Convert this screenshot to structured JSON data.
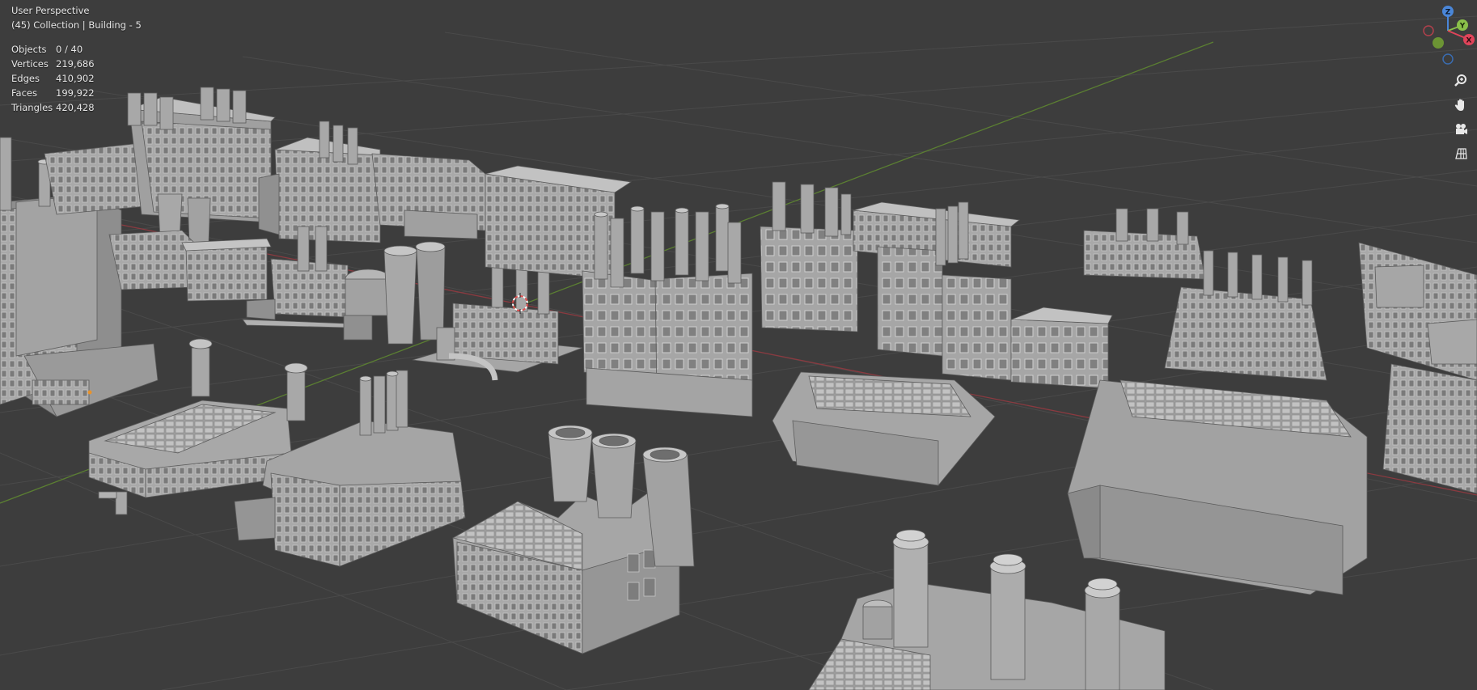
{
  "viewport": {
    "title": "User Perspective",
    "collection": "(45) Collection | Building - 5",
    "background": "#3d3d3d",
    "grid_color": "#4a4a4a",
    "x_axis_color": "#c0404a",
    "y_axis_color": "#6a9a3a"
  },
  "stats": [
    {
      "label": "Objects",
      "value": "0 / 40"
    },
    {
      "label": "Vertices",
      "value": "219,686"
    },
    {
      "label": "Edges",
      "value": "410,902"
    },
    {
      "label": "Faces",
      "value": "199,922"
    },
    {
      "label": "Triangles",
      "value": "420,428"
    }
  ],
  "gizmo": {
    "axes": [
      {
        "name": "X",
        "color": "#e0445a"
      },
      {
        "name": "Y",
        "color": "#8ac04a"
      },
      {
        "name": "Z",
        "color": "#4a86d8"
      }
    ]
  },
  "tools": [
    {
      "name": "zoom-icon"
    },
    {
      "name": "pan-hand-icon"
    },
    {
      "name": "camera-icon"
    },
    {
      "name": "ortho-grid-icon"
    }
  ],
  "scene": {
    "building_light": "#b9b9b9",
    "building_side": "#8e8e8e",
    "building_dark": "#6f6f6f"
  }
}
